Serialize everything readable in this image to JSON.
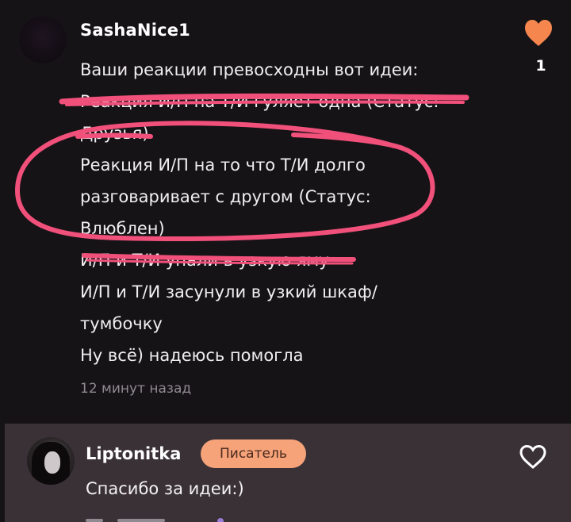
{
  "main_comment": {
    "username": "SashaNice1",
    "like_count": "1",
    "lines": [
      "Ваши реакции превосходны вот идеи:",
      "Реакция И/П на Т/И гуляет одна (Статус:",
      "Друзья)",
      "Реакция И/П на то что Т/И долго",
      "разговаривает с другом (Статус:",
      "Влюблен)",
      "И/П и Т/И упали в узкую яму",
      "И/П и Т/И засунули в узкий шкаф/",
      "тумбочку",
      "Ну всё) надеюсь помогла"
    ],
    "timestamp": "12 минут назад",
    "icons": {
      "like": "heart-filled-icon"
    }
  },
  "reply_comment": {
    "username": "Liptonitka",
    "badge": "Писатель",
    "text": "Спасибо за идеи:)",
    "icons": {
      "like": "heart-outline-icon"
    }
  },
  "colors": {
    "background": "#161317",
    "reply_background": "#3a3136",
    "heart": "#f5874e",
    "badge": "#f6a37a",
    "annotation": "#f0507a",
    "timestamp": "#8e8a8f"
  }
}
